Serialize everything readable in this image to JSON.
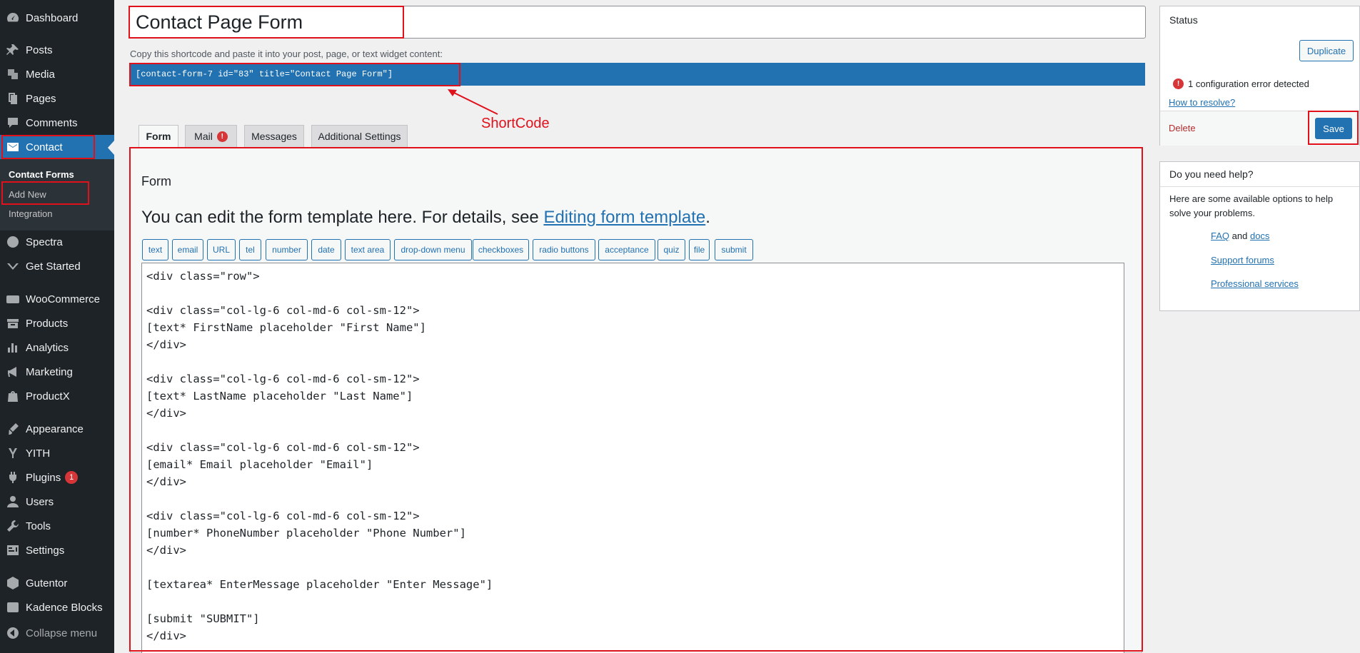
{
  "sidebar": {
    "items": [
      {
        "label": "Dashboard",
        "icon": "dashboard-icon"
      },
      {
        "label": "Posts",
        "icon": "pin-icon"
      },
      {
        "label": "Media",
        "icon": "media-icon"
      },
      {
        "label": "Pages",
        "icon": "pages-icon"
      },
      {
        "label": "Comments",
        "icon": "comment-icon"
      },
      {
        "label": "Contact",
        "icon": "envelope-icon"
      },
      {
        "label": "Spectra",
        "icon": "spectra-icon"
      },
      {
        "label": "Get Started",
        "icon": "get-started-icon"
      },
      {
        "label": "WooCommerce",
        "icon": "woo-icon"
      },
      {
        "label": "Products",
        "icon": "archive-icon"
      },
      {
        "label": "Analytics",
        "icon": "bar-chart-icon"
      },
      {
        "label": "Marketing",
        "icon": "megaphone-icon"
      },
      {
        "label": "ProductX",
        "icon": "bag-icon"
      },
      {
        "label": "Appearance",
        "icon": "brush-icon"
      },
      {
        "label": "YITH",
        "icon": "yith-icon"
      },
      {
        "label": "Plugins",
        "icon": "plug-icon",
        "badge": "1"
      },
      {
        "label": "Users",
        "icon": "user-icon"
      },
      {
        "label": "Tools",
        "icon": "wrench-icon"
      },
      {
        "label": "Settings",
        "icon": "settings-icon"
      },
      {
        "label": "Gutentor",
        "icon": "gutentor-icon"
      },
      {
        "label": "Kadence Blocks",
        "icon": "kadence-icon"
      },
      {
        "label": "Collapse menu",
        "icon": "collapse-icon"
      }
    ],
    "submenu": [
      "Contact Forms",
      "Add New",
      "Integration"
    ]
  },
  "editor": {
    "title": "Contact Page Form",
    "shortcode_desc": "Copy this shortcode and paste it into your post, page, or text widget content:",
    "shortcode": "[contact-form-7 id=\"83\" title=\"Contact Page Form\"]",
    "annotation_label": "ShortCode"
  },
  "tabs": [
    "Form",
    "Mail",
    "Messages",
    "Additional Settings"
  ],
  "tab_error_mark": "!",
  "form": {
    "heading": "Form",
    "intro_prefix": "You can edit the form template here. For details, see ",
    "intro_link": "Editing form template",
    "intro_suffix": ".",
    "tag_buttons": [
      "text",
      "email",
      "URL",
      "tel",
      "number",
      "date",
      "text area",
      "drop-down menu",
      "checkboxes",
      "radio buttons",
      "acceptance",
      "quiz",
      "file",
      "submit"
    ],
    "code_lines": [
      "<div class=\"row\">",
      "",
      "<div class=\"col-lg-6 col-md-6 col-sm-12\">",
      "[text* FirstName placeholder \"First Name\"]",
      "</div>",
      "",
      "<div class=\"col-lg-6 col-md-6 col-sm-12\">",
      "[text* LastName placeholder \"Last Name\"]",
      "</div>",
      "",
      "<div class=\"col-lg-6 col-md-6 col-sm-12\">",
      "[email* Email placeholder \"Email\"]",
      "</div>",
      "",
      "<div class=\"col-lg-6 col-md-6 col-sm-12\">",
      "[number* PhoneNumber placeholder \"Phone Number\"]",
      "</div>",
      "",
      "[textarea* EnterMessage placeholder \"Enter Message\"]",
      "",
      "[submit \"SUBMIT\"]",
      "</div>"
    ]
  },
  "status": {
    "title": "Status",
    "duplicate": "Duplicate",
    "error_text": "1 configuration error detected",
    "resolve_link": "How to resolve?",
    "delete": "Delete",
    "save": "Save"
  },
  "help": {
    "title": "Do you need help?",
    "text": "Here are some available options to help solve your problems.",
    "faq": "FAQ",
    "and": "and",
    "docs": "docs",
    "support": "Support forums",
    "professional": "Professional services"
  },
  "colors": {
    "sidebar_bg": "#1d2327",
    "accent": "#2271b1",
    "annotation": "#e0111b",
    "error": "#d63638"
  }
}
